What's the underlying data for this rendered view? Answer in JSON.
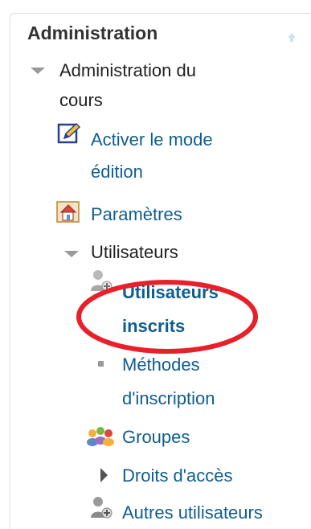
{
  "block": {
    "title": "Administration",
    "collapse_icon": "collapse-arrow-icon"
  },
  "tree": {
    "course_admin": {
      "label_line1": "Administration du",
      "label_line2": "cours"
    },
    "edit_mode": {
      "label_line1": "Activer le mode",
      "label_line2": "édition",
      "icon": "edit-pencil-icon"
    },
    "settings": {
      "label": "Paramètres",
      "icon": "settings-icon"
    },
    "users": {
      "label": "Utilisateurs",
      "enrolled": {
        "label_line1": "Utilisateurs",
        "label_line2": "inscrits",
        "icon": "enrolled-users-icon",
        "highlighted": true,
        "highlight_color": "#e8202a"
      },
      "enrol_methods": {
        "label_line1": "Méthodes",
        "label_line2": "d'inscription"
      },
      "groups": {
        "label": "Groupes",
        "icon": "groups-icon"
      },
      "permissions": {
        "label": "Droits d'accès"
      },
      "other_users": {
        "label": "Autres utilisateurs",
        "icon": "other-users-icon"
      }
    }
  },
  "colors": {
    "link": "#0f5d91",
    "text": "#222222",
    "title": "#333333"
  }
}
